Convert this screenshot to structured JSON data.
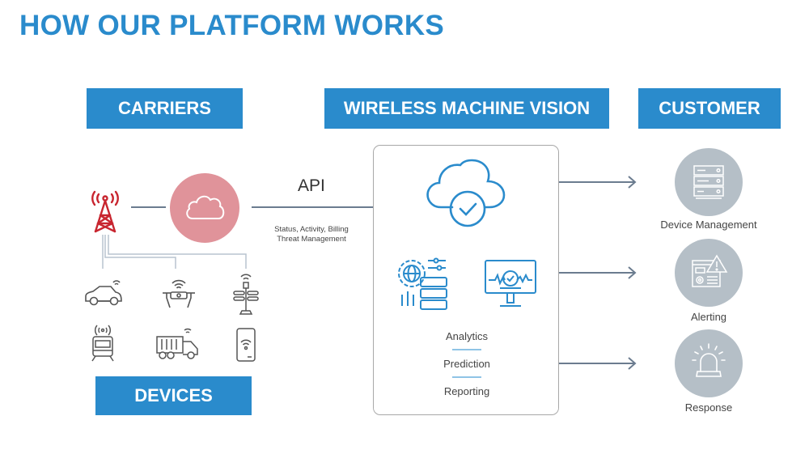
{
  "title": "HOW OUR PLATFORM WORKS",
  "colors": {
    "brand_blue": "#2a8bcc",
    "carrier_red": "#c8252f",
    "cloud_pink": "#e0939a",
    "connector_gray": "#6b7c8f",
    "customer_circle": "#b5bfc7",
    "icon_gray": "#555555"
  },
  "sections": {
    "carriers": {
      "label": "CARRIERS",
      "icons": [
        "cell-tower-icon",
        "cloud-icon"
      ]
    },
    "api": {
      "label": "API",
      "subtitle_line1": "Status, Activity, Billing",
      "subtitle_line2": "Threat Management"
    },
    "devices": {
      "label": "DEVICES",
      "items": [
        {
          "icon": "connected-car-icon"
        },
        {
          "icon": "drone-icon"
        },
        {
          "icon": "smart-streetlight-icon"
        },
        {
          "icon": "connected-train-icon"
        },
        {
          "icon": "connected-truck-icon"
        },
        {
          "icon": "smartphone-icon"
        }
      ]
    },
    "wireless_machine_vision": {
      "label": "WIRELESS MACHINE VISION",
      "icons": [
        "cloud-check-icon",
        "server-globe-icon",
        "monitor-check-icon"
      ],
      "features": [
        "Analytics",
        "Prediction",
        "Reporting"
      ]
    },
    "customer": {
      "label": "CUSTOMER",
      "items": [
        {
          "label": "Device Management",
          "icon": "server-rack-icon"
        },
        {
          "label": "Alerting",
          "icon": "alert-window-icon"
        },
        {
          "label": "Response",
          "icon": "siren-icon"
        }
      ]
    }
  }
}
